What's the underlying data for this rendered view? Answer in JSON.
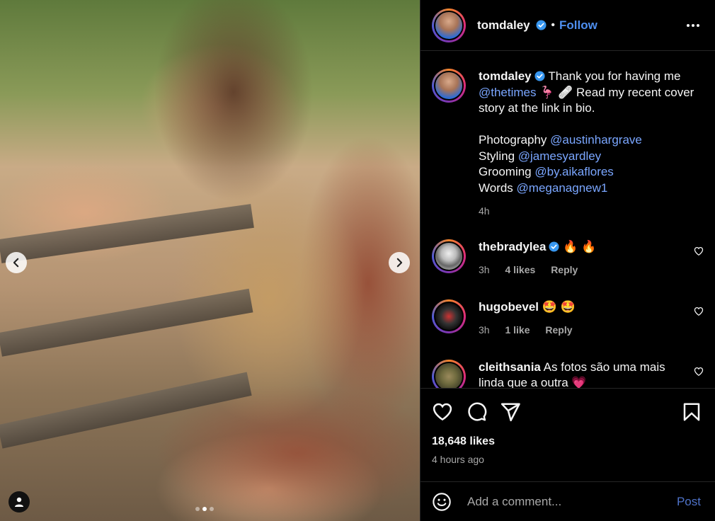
{
  "post": {
    "username": "tomdaley",
    "follow_label": "Follow",
    "separator": "•",
    "carousel_pages": 3,
    "carousel_active_index": 1
  },
  "caption": {
    "username": "tomdaley",
    "text_1": "Thank you for having me",
    "mention_1": "@thetimes",
    "text_2": "🦩 🩹  Read my recent cover story at the link in bio.",
    "photo_label": "Photography",
    "photo_mention": "@austinhargrave",
    "styling_label": "Styling",
    "styling_mention": "@jamesyardley",
    "grooming_label": "Grooming",
    "grooming_mention": "@by.aikaflores",
    "words_label": "Words",
    "words_mention": "@meganagnew1",
    "time": "4h"
  },
  "comments": [
    {
      "username": "thebradylea",
      "text": "🔥 🔥",
      "time": "3h",
      "likes": "4 likes",
      "reply": "Reply",
      "verified": true
    },
    {
      "username": "hugobevel",
      "text": "🤩 🤩",
      "time": "3h",
      "likes": "1 like",
      "reply": "Reply",
      "verified": false
    },
    {
      "username": "cleithsania",
      "text": "As fotos são uma mais linda que a outra 💗",
      "verified": false
    }
  ],
  "stats": {
    "likes": "18,648 likes",
    "posted": "4 hours ago"
  },
  "add_comment": {
    "placeholder": "Add a comment...",
    "post_label": "Post"
  },
  "colors": {
    "accent": "#4e8ff0",
    "mention": "#7aa6ff",
    "muted": "#a8a8a8",
    "verified": "#3897f0"
  }
}
